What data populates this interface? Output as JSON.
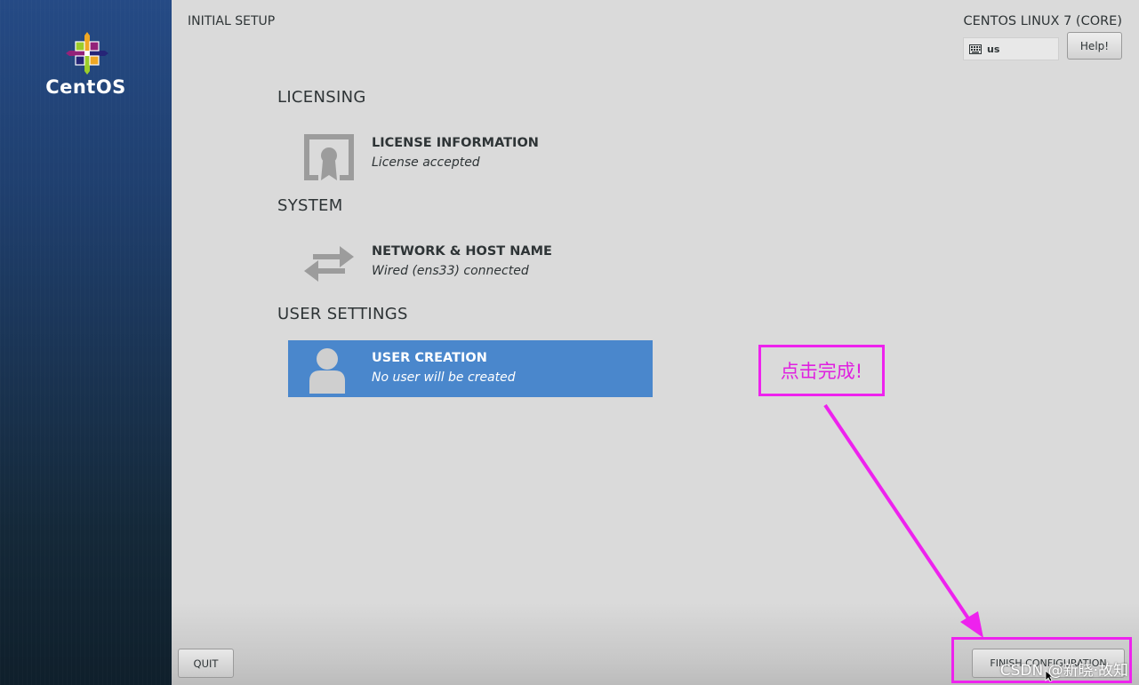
{
  "sidebar": {
    "logo_text": "CentOS"
  },
  "header": {
    "title": "INITIAL SETUP",
    "product": "CENTOS LINUX 7 (CORE)",
    "keyboard_layout": "us",
    "help_label": "Help!"
  },
  "sections": [
    {
      "header": "LICENSING",
      "spokes": [
        {
          "title": "LICENSE INFORMATION",
          "status": "License accepted",
          "icon": "license-icon"
        }
      ]
    },
    {
      "header": "SYSTEM",
      "spokes": [
        {
          "title": "NETWORK & HOST NAME",
          "status": "Wired (ens33) connected",
          "icon": "network-arrows-icon"
        }
      ]
    },
    {
      "header": "USER SETTINGS",
      "spokes": [
        {
          "title": "USER CREATION",
          "status": "No user will be created",
          "icon": "user-icon",
          "selected": true
        }
      ]
    }
  ],
  "footer": {
    "quit_label": "QUIT",
    "finish_label": "FINISH CONFIGURATION"
  },
  "annotation": {
    "callout_text": "点击完成!",
    "color": "#ee22ee"
  },
  "watermark": "CSDN @新晓·故知",
  "colors": {
    "selected_spoke": "#4a87cc",
    "sidebar_top": "#254a85",
    "sidebar_bottom": "#0f1f2b",
    "main_bg": "#dadada"
  }
}
